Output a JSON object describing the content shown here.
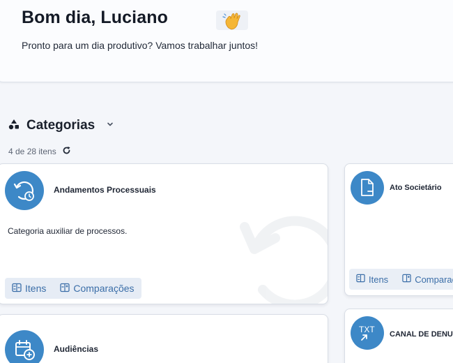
{
  "greeting": {
    "title": "Bom dia, Luciano",
    "subtitle": "Pronto para um dia produtivo? Vamos trabalhar juntos!",
    "emoji": "👋"
  },
  "section": {
    "title": "Categorias",
    "icon": "shapes-icon",
    "count_text": "4 de 28 itens",
    "refresh_icon": "refresh-icon"
  },
  "categories": [
    {
      "title": "Andamentos Processuais",
      "description": "Categoria auxiliar de processos.",
      "icon": "history-clock-icon",
      "actions": {
        "items": "Itens",
        "comparisons": "Comparações"
      }
    },
    {
      "title": "Ato Societário",
      "description": "",
      "icon": "document-minus-icon",
      "actions": {
        "items": "Itens",
        "comparisons": "Comparaçõ"
      }
    },
    {
      "title": "Audiências",
      "icon": "calendar-plus-icon"
    },
    {
      "title": "CANAL DE DENUN",
      "icon": "txt-file-icon"
    }
  ],
  "colors": {
    "accent": "#3d88c7",
    "action_text": "#3b6ea8",
    "action_bg": "#e6ecf5"
  }
}
